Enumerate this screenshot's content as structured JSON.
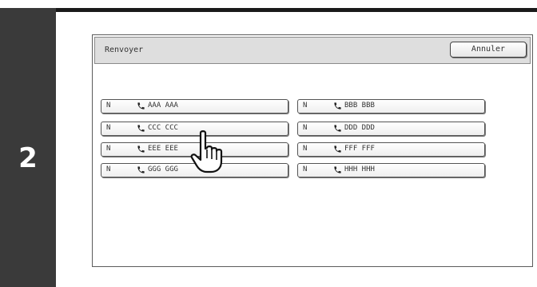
{
  "step": {
    "number": "2"
  },
  "dialog": {
    "title": "Renvoyer",
    "cancel_label": "Annuler"
  },
  "destinations": [
    {
      "mode": "N",
      "icon": "phone-icon",
      "name": "AAA AAA"
    },
    {
      "mode": "N",
      "icon": "phone-icon",
      "name": "BBB BBB"
    },
    {
      "mode": "N",
      "icon": "phone-icon",
      "name": "CCC CCC"
    },
    {
      "mode": "N",
      "icon": "phone-icon",
      "name": "DDD DDD"
    },
    {
      "mode": "N",
      "icon": "phone-icon",
      "name": "EEE EEE"
    },
    {
      "mode": "N",
      "icon": "phone-icon",
      "name": "FFF FFF"
    },
    {
      "mode": "N",
      "icon": "phone-icon",
      "name": "GGG GGG"
    },
    {
      "mode": "N",
      "icon": "phone-icon",
      "name": "HHH HHH"
    }
  ],
  "pointer": {
    "icon": "hand-pointer-icon"
  },
  "colors": {
    "step_panel": "#3a3a3a",
    "title_bar": "#dedede"
  }
}
